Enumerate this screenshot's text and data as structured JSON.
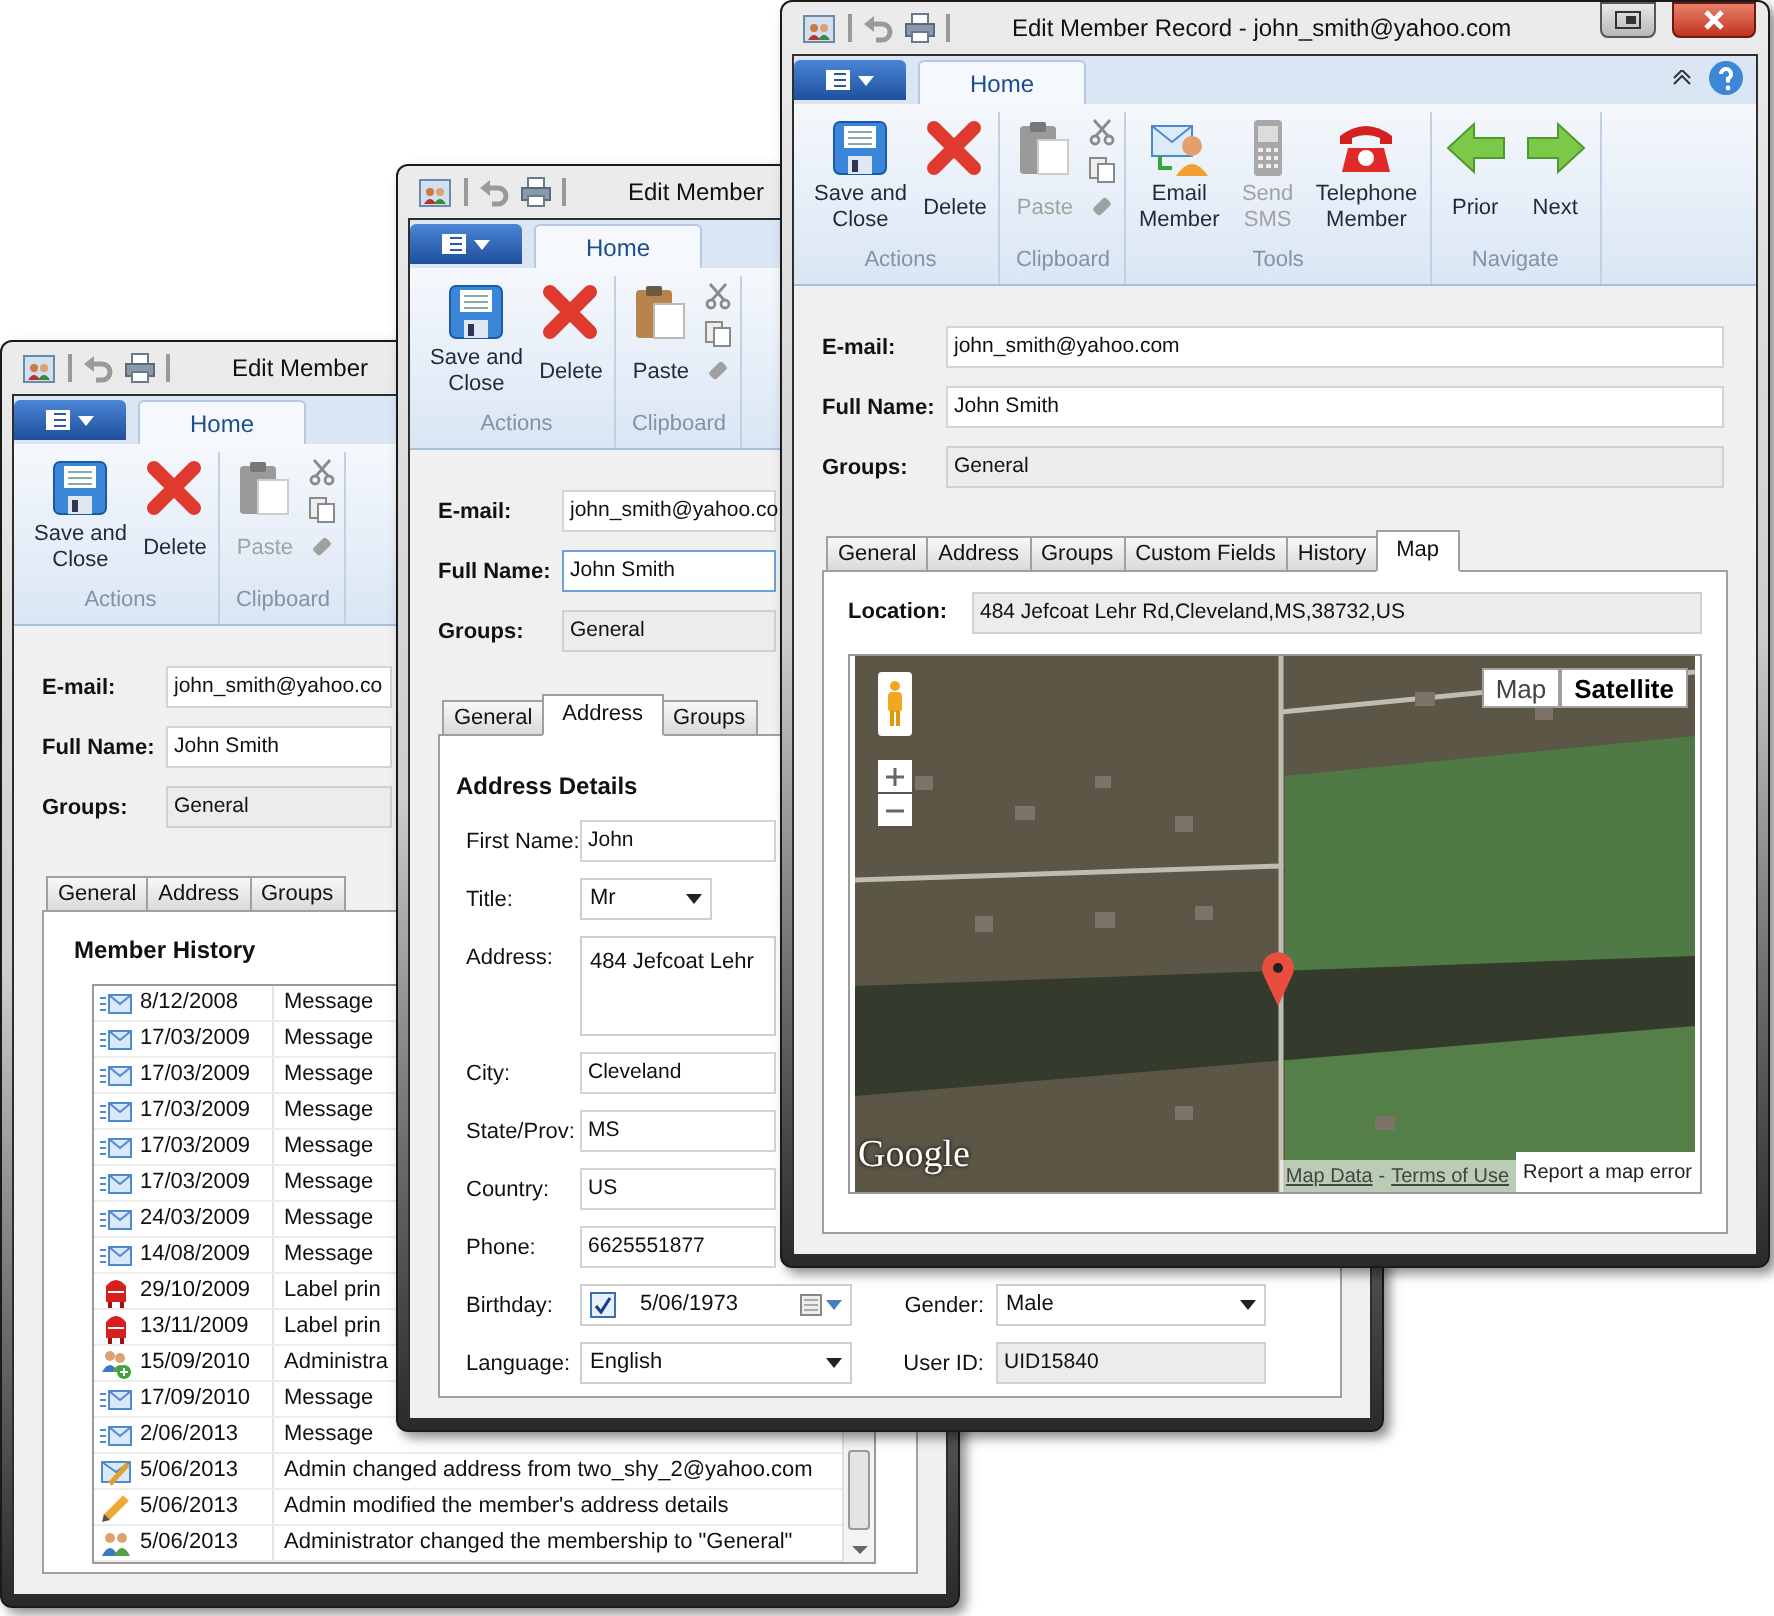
{
  "windows": [
    {
      "title": "Edit Member",
      "caption_buttons": false,
      "ribbon": {
        "tab": "Home",
        "groups": [
          {
            "label": "Actions",
            "buttons": [
              {
                "kind": "save",
                "label": [
                  "Save and",
                  "Close"
                ],
                "disabled": false
              },
              {
                "kind": "delete",
                "label": [
                  "Delete"
                ],
                "disabled": false
              }
            ]
          },
          {
            "label": "Clipboard",
            "buttons": [
              {
                "kind": "paste",
                "label": [
                  "Paste"
                ],
                "disabled": true
              }
            ],
            "small_buttons": [
              {
                "kind": "cut"
              },
              {
                "kind": "copy"
              },
              {
                "kind": "eraser"
              }
            ]
          }
        ]
      },
      "fields": [
        {
          "label": "E-mail:",
          "value": "john_smith@yahoo.co",
          "readonly": false,
          "focused": false
        },
        {
          "label": "Full Name:",
          "value": "John Smith",
          "readonly": false,
          "focused": false
        },
        {
          "label": "Groups:",
          "value": "General",
          "readonly": true,
          "focused": false
        }
      ],
      "tabs": [
        {
          "label": "General",
          "selected": false
        },
        {
          "label": "Address",
          "selected": false
        },
        {
          "label": "Groups",
          "selected": false
        }
      ],
      "panel": {
        "kind": "history",
        "title": "Member History",
        "rows": [
          {
            "kind": "message",
            "date": "8/12/2008",
            "text": "Message"
          },
          {
            "kind": "message",
            "date": "17/03/2009",
            "text": "Message"
          },
          {
            "kind": "message",
            "date": "17/03/2009",
            "text": "Message"
          },
          {
            "kind": "message",
            "date": "17/03/2009",
            "text": "Message"
          },
          {
            "kind": "message",
            "date": "17/03/2009",
            "text": "Message"
          },
          {
            "kind": "message",
            "date": "17/03/2009",
            "text": "Message"
          },
          {
            "kind": "message",
            "date": "24/03/2009",
            "text": "Message"
          },
          {
            "kind": "message",
            "date": "14/08/2009",
            "text": "Message"
          },
          {
            "kind": "label",
            "date": "29/10/2009",
            "text": "Label prin"
          },
          {
            "kind": "label",
            "date": "13/11/2009",
            "text": "Label prin"
          },
          {
            "kind": "admin_add",
            "date": "15/09/2010",
            "text": "Administra"
          },
          {
            "kind": "message",
            "date": "17/09/2010",
            "text": "Message"
          },
          {
            "kind": "message",
            "date": "2/06/2013",
            "text": "Message"
          },
          {
            "kind": "edit_message",
            "date": "5/06/2013",
            "text": "Admin changed address from two_shy_2@yahoo.com"
          },
          {
            "kind": "edit",
            "date": "5/06/2013",
            "text": "Admin modified the member's address details"
          },
          {
            "kind": "group",
            "date": "5/06/2013",
            "text": "Administrator changed the membership to \"General\""
          }
        ]
      }
    },
    {
      "title": "Edit Member",
      "caption_buttons": false,
      "ribbon": {
        "tab": "Home",
        "groups": [
          {
            "label": "Actions",
            "buttons": [
              {
                "kind": "save",
                "label": [
                  "Save and",
                  "Close"
                ],
                "disabled": false
              },
              {
                "kind": "delete",
                "label": [
                  "Delete"
                ],
                "disabled": false
              }
            ]
          },
          {
            "label": "Clipboard",
            "buttons": [
              {
                "kind": "paste",
                "label": [
                  "Paste"
                ],
                "disabled": false
              }
            ],
            "small_buttons": [
              {
                "kind": "cut"
              },
              {
                "kind": "copy"
              },
              {
                "kind": "eraser"
              }
            ]
          }
        ]
      },
      "fields": [
        {
          "label": "E-mail:",
          "value": "john_smith@yahoo.co",
          "readonly": false,
          "focused": false
        },
        {
          "label": "Full Name:",
          "value": "John Smith",
          "readonly": false,
          "focused": true
        },
        {
          "label": "Groups:",
          "value": "General",
          "readonly": true,
          "focused": false
        }
      ],
      "tabs": [
        {
          "label": "General",
          "selected": false
        },
        {
          "label": "Address",
          "selected": true
        },
        {
          "label": "Groups",
          "selected": false
        }
      ],
      "panel": {
        "kind": "address",
        "title": "Address Details",
        "rows": [
          {
            "label": "First Name:",
            "kind": "text",
            "value": "John"
          },
          {
            "label": "Title:",
            "kind": "select",
            "value": "Mr"
          },
          {
            "label": "Address:",
            "kind": "textarea",
            "value": "484 Jefcoat Lehr"
          },
          {
            "label": "City:",
            "kind": "text",
            "value": "Cleveland"
          },
          {
            "label": "State/Prov:",
            "kind": "text",
            "value": "MS"
          },
          {
            "label": "Country:",
            "kind": "text",
            "value": "US"
          },
          {
            "label": "Phone:",
            "kind": "text",
            "value": "6625551877"
          }
        ],
        "pairs": [
          {
            "left": {
              "label": "Birthday:",
              "kind": "date",
              "value": "5/06/1973",
              "checked": true
            },
            "right": {
              "label": "Gender:",
              "kind": "select",
              "value": "Male"
            }
          },
          {
            "left": {
              "label": "Language:",
              "kind": "select",
              "value": "English"
            },
            "right": {
              "label": "User ID:",
              "kind": "readonly",
              "value": "UID15840"
            }
          }
        ]
      }
    },
    {
      "title": "Edit Member Record - john_smith@yahoo.com",
      "caption_buttons": true,
      "ribbon": {
        "tab": "Home",
        "help": true,
        "groups": [
          {
            "label": "Actions",
            "buttons": [
              {
                "kind": "save",
                "label": [
                  "Save and",
                  "Close"
                ],
                "disabled": false
              },
              {
                "kind": "delete",
                "label": [
                  "Delete"
                ],
                "disabled": false
              }
            ]
          },
          {
            "label": "Clipboard",
            "buttons": [
              {
                "kind": "paste",
                "label": [
                  "Paste"
                ],
                "disabled": true
              }
            ],
            "small_buttons": [
              {
                "kind": "cut"
              },
              {
                "kind": "copy"
              },
              {
                "kind": "eraser"
              }
            ]
          },
          {
            "label": "Tools",
            "buttons": [
              {
                "kind": "email",
                "label": [
                  "Email",
                  "Member"
                ],
                "disabled": false
              },
              {
                "kind": "sms",
                "label": [
                  "Send",
                  "SMS"
                ],
                "disabled": true
              },
              {
                "kind": "telephone",
                "label": [
                  "Telephone",
                  "Member"
                ],
                "disabled": false
              }
            ]
          },
          {
            "label": "Navigate",
            "buttons": [
              {
                "kind": "prior",
                "label": [
                  "Prior"
                ],
                "disabled": false
              },
              {
                "kind": "next",
                "label": [
                  "Next"
                ],
                "disabled": false
              }
            ]
          }
        ]
      },
      "fields": [
        {
          "label": "E-mail:",
          "value": "john_smith@yahoo.com",
          "readonly": false,
          "focused": false
        },
        {
          "label": "Full Name:",
          "value": "John Smith",
          "readonly": false,
          "focused": false
        },
        {
          "label": "Groups:",
          "value": "General",
          "readonly": true,
          "focused": false
        }
      ],
      "tabs": [
        {
          "label": "General",
          "selected": false
        },
        {
          "label": "Address",
          "selected": false
        },
        {
          "label": "Groups",
          "selected": false
        },
        {
          "label": "Custom Fields",
          "selected": false
        },
        {
          "label": "History",
          "selected": false
        },
        {
          "label": "Map",
          "selected": true
        }
      ],
      "panel": {
        "kind": "map",
        "location_label": "Location:",
        "location": "484 Jefcoat Lehr Rd,Cleveland,MS,38732,US",
        "map_types": [
          {
            "label": "Map",
            "selected": false
          },
          {
            "label": "Satellite",
            "selected": true
          }
        ],
        "logo": "Google",
        "links": [
          "Map Data",
          "Terms of Use"
        ],
        "separator": "-",
        "report": "Report a map error"
      }
    }
  ]
}
